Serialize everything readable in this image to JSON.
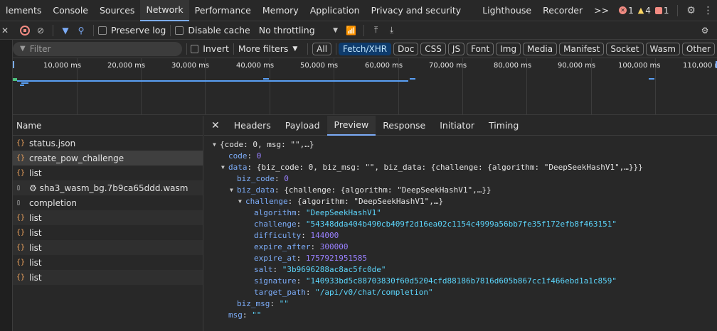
{
  "tabs": {
    "items": [
      "lements",
      "Console",
      "Sources",
      "Network",
      "Performance",
      "Memory",
      "Application",
      "Privacy and security",
      "Lighthouse",
      "Recorder"
    ],
    "more": ">>",
    "errors": "1",
    "warnings": "4",
    "issues": "1"
  },
  "toolbar": {
    "preserve_log": "Preserve log",
    "disable_cache": "Disable cache",
    "throttling": "No throttling"
  },
  "filter": {
    "placeholder": "Filter",
    "invert": "Invert",
    "more_filters": "More filters",
    "chips": [
      "All",
      "Fetch/XHR",
      "Doc",
      "CSS",
      "JS",
      "Font",
      "Img",
      "Media",
      "Manifest",
      "Socket",
      "Wasm",
      "Other"
    ]
  },
  "timeline": {
    "ticks": [
      "10,000 ms",
      "20,000 ms",
      "30,000 ms",
      "40,000 ms",
      "50,000 ms",
      "60,000 ms",
      "70,000 ms",
      "80,000 ms",
      "90,000 ms",
      "100,000 ms",
      "110,000 ms"
    ]
  },
  "requests": {
    "header": "Name",
    "rows": [
      {
        "name": "status.json",
        "type": "xhr"
      },
      {
        "name": "create_pow_challenge",
        "type": "xhr"
      },
      {
        "name": "list",
        "type": "xhr"
      },
      {
        "name": "⚙ sha3_wasm_bg.7b9ca65ddd.wasm",
        "type": "doc"
      },
      {
        "name": "completion",
        "type": "doc"
      },
      {
        "name": "list",
        "type": "xhr"
      },
      {
        "name": "list",
        "type": "xhr"
      },
      {
        "name": "list",
        "type": "xhr"
      },
      {
        "name": "list",
        "type": "xhr"
      },
      {
        "name": "list",
        "type": "xhr"
      }
    ]
  },
  "detail": {
    "tabs": [
      "Headers",
      "Payload",
      "Preview",
      "Response",
      "Initiator",
      "Timing"
    ],
    "active_tab": "Preview"
  },
  "preview": {
    "root": "{code: 0, msg: \"\",…}",
    "code_k": "code",
    "code_v": "0",
    "data_k": "data",
    "data_v": "{biz_code: 0, biz_msg: \"\", biz_data: {challenge: {algorithm: \"DeepSeekHashV1\",…}}}",
    "biz_code_k": "biz_code",
    "biz_code_v": "0",
    "biz_data_k": "biz_data",
    "biz_data_v": "{challenge: {algorithm: \"DeepSeekHashV1\",…}}",
    "challenge_k": "challenge",
    "challenge_v": "{algorithm: \"DeepSeekHashV1\",…}",
    "algorithm_k": "algorithm",
    "algorithm_v": "\"DeepSeekHashV1\"",
    "challenge2_k": "challenge",
    "challenge2_v": "\"54348dda404b490cb409f2d16ea02c1154c4999a56bb7fe35f172efb8f463151\"",
    "difficulty_k": "difficulty",
    "difficulty_v": "144000",
    "expire_after_k": "expire_after",
    "expire_after_v": "300000",
    "expire_at_k": "expire_at",
    "expire_at_v": "1757921951585",
    "salt_k": "salt",
    "salt_v": "\"3b9696288ac8ac5fc0de\"",
    "signature_k": "signature",
    "signature_v": "\"140933bd5c88703830f60d5204cfd88186b7816d605b867cc1f466ebd1a1c859\"",
    "target_path_k": "target_path",
    "target_path_v": "\"/api/v0/chat/completion\"",
    "biz_msg_k": "biz_msg",
    "biz_msg_v": "\"\"",
    "msg_k": "msg",
    "msg_v": "\"\""
  },
  "colors": {
    "accent": "#7cacf8",
    "key": "#7cacf8",
    "number": "#9980ff",
    "string": "#5cd5fb",
    "error": "#f28b82",
    "warning": "#fdd663"
  }
}
